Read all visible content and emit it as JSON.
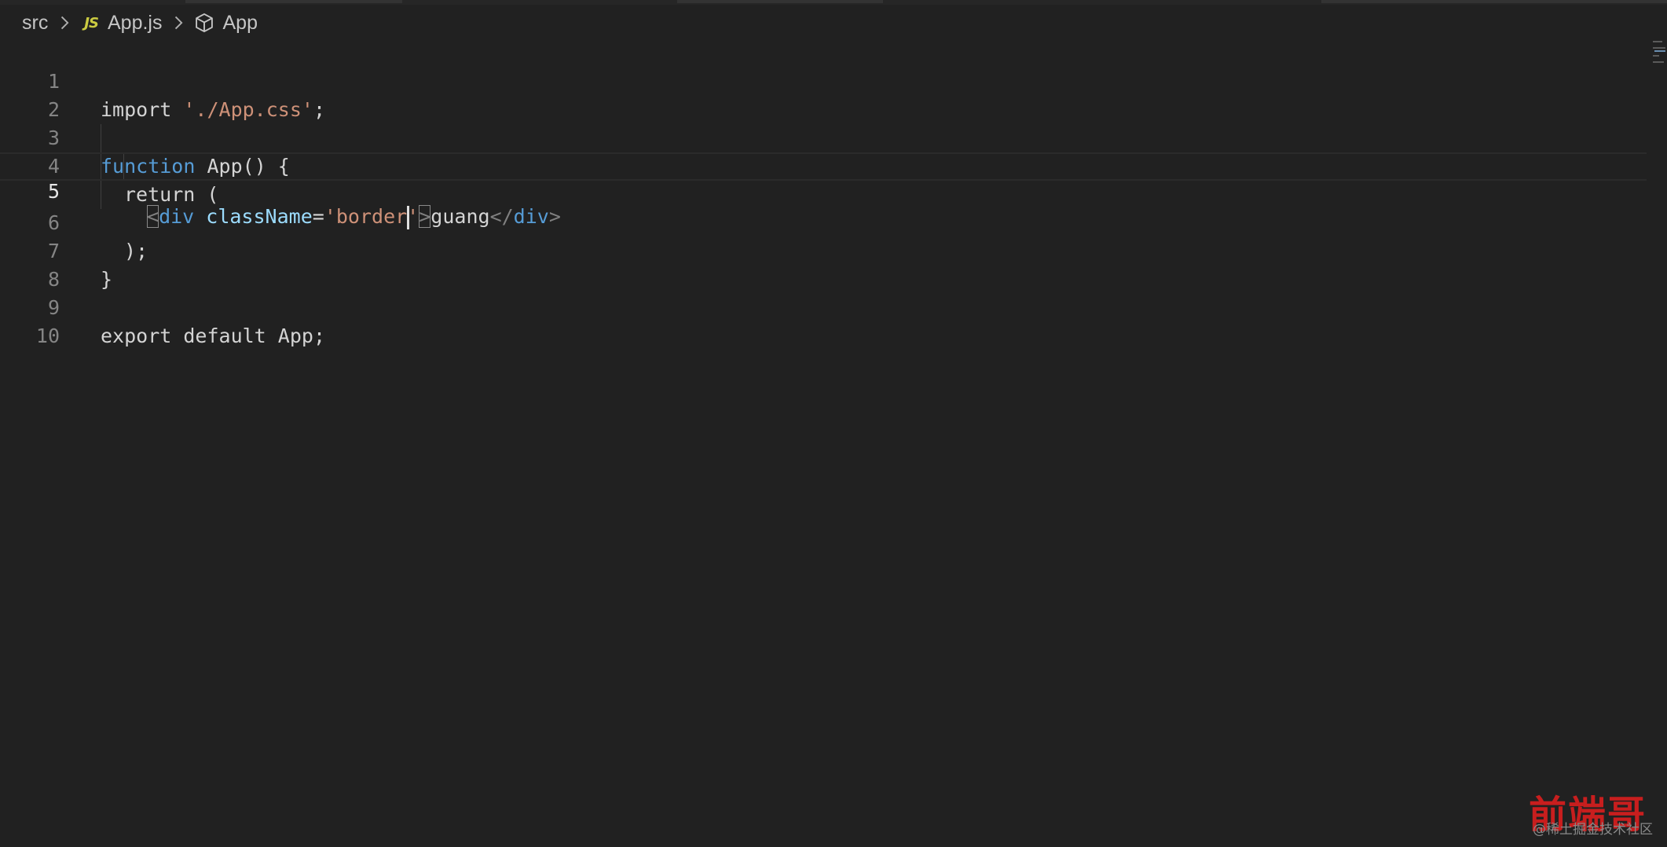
{
  "breadcrumb": {
    "folder": "src",
    "file_badge": "JS",
    "file": "App.js",
    "symbol": "App",
    "symbol_icon": "cube-icon",
    "separator_icon": "chevron-right-icon"
  },
  "editor": {
    "current_line": 5,
    "lines": [
      {
        "number": "1",
        "tokens": [
          "import",
          " ",
          "'./App.css'",
          ";"
        ]
      },
      {
        "number": "2",
        "tokens": []
      },
      {
        "number": "3",
        "tokens": [
          "function",
          " ",
          "App",
          "() {"
        ]
      },
      {
        "number": "4",
        "tokens": [
          "return",
          " ("
        ]
      },
      {
        "number": "5",
        "tokens": [
          "<",
          "div",
          " ",
          "className",
          "=",
          "'border",
          "'",
          ">",
          "guang",
          "</",
          "div",
          ">"
        ]
      },
      {
        "number": "6",
        "tokens": [
          ");"
        ]
      },
      {
        "number": "7",
        "tokens": [
          "}"
        ]
      },
      {
        "number": "8",
        "tokens": []
      },
      {
        "number": "9",
        "tokens": [
          "export",
          " ",
          "default",
          " ",
          "App",
          ";"
        ]
      },
      {
        "number": "10",
        "tokens": []
      }
    ]
  },
  "watermark": {
    "logo": "前端哥",
    "text": "@稀土掘金技术社区"
  },
  "colors": {
    "background": "#212121",
    "keyword": "#569cd6",
    "string": "#ce9178",
    "attribute": "#9cdcfe",
    "line_number": "#858585",
    "js_badge": "#cbcb41",
    "watermark_logo": "#c81e1e"
  }
}
